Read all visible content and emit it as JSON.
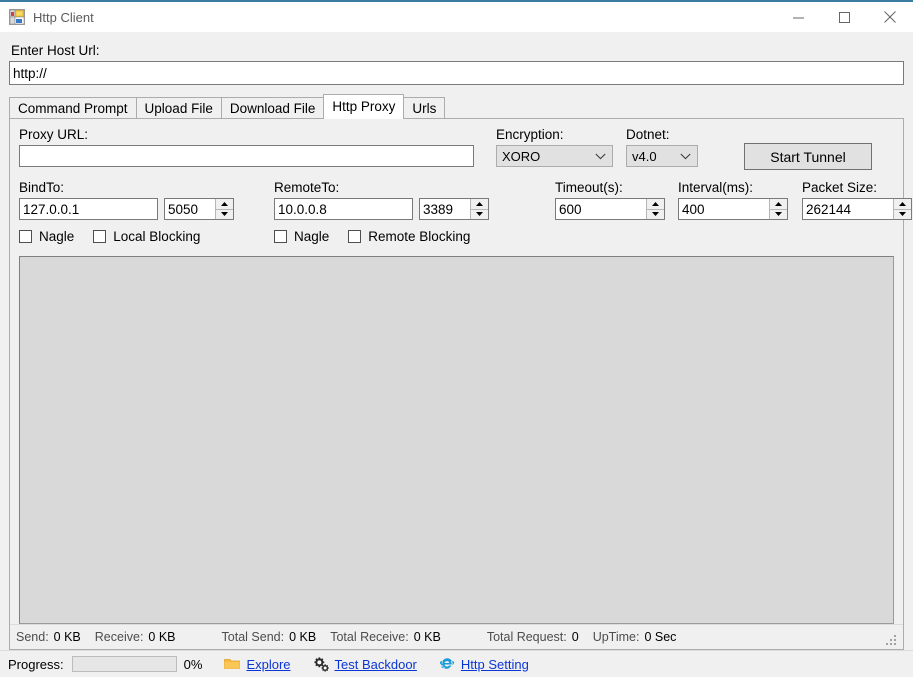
{
  "window": {
    "title": "Http Client",
    "icon": "winforms-app-icon",
    "controls": {
      "minimize": "minimize-icon",
      "maximize": "maximize-icon",
      "close": "close-icon"
    },
    "accent_color": "#3a7ca0"
  },
  "host": {
    "label": "Enter Host Url:",
    "value": "http://",
    "placeholder": ""
  },
  "tabs": [
    {
      "label": "Command Prompt",
      "active": false
    },
    {
      "label": "Upload File",
      "active": false
    },
    {
      "label": "Download File",
      "active": false
    },
    {
      "label": "Http Proxy",
      "active": true
    },
    {
      "label": "Urls",
      "active": false
    }
  ],
  "proxy": {
    "url_label": "Proxy URL:",
    "url_value": "",
    "url_placeholder": "",
    "encryption_label": "Encryption:",
    "encryption_value": "XORO",
    "dotnet_label": "Dotnet:",
    "dotnet_value": "v4.0",
    "start_button": "Start Tunnel",
    "bindto_label": "BindTo:",
    "bindto_host": "127.0.0.1",
    "bindto_port": "5050",
    "remoteto_label": "RemoteTo:",
    "remoteto_host": "10.0.0.8",
    "remoteto_port": "3389",
    "local_nagle_label": "Nagle",
    "local_blocking_label": "Local Blocking",
    "remote_nagle_label": "Nagle",
    "remote_blocking_label": "Remote Blocking",
    "timeout_label": "Timeout(s):",
    "timeout_value": "600",
    "interval_label": "Interval(ms):",
    "interval_value": "400",
    "packet_label": "Packet Size:",
    "packet_value": "262144",
    "log_text": ""
  },
  "inner_status": {
    "send_key": "Send:",
    "send_val": "0 KB",
    "receive_key": "Receive:",
    "receive_val": "0 KB",
    "total_send_key": "Total Send:",
    "total_send_val": "0 KB",
    "total_receive_key": "Total Receive:",
    "total_receive_val": "0 KB",
    "total_request_key": "Total Request:",
    "total_request_val": "0",
    "uptime_key": "UpTime:",
    "uptime_val": "0 Sec"
  },
  "statusbar": {
    "progress_label": "Progress:",
    "progress_percent": "0%",
    "progress_value": 0,
    "explore_label": "Explore",
    "explore_icon": "folder-icon",
    "backdoor_label": "Test Backdoor",
    "backdoor_icon": "gears-icon",
    "setting_label": "Http Setting",
    "setting_icon": "internet-explorer-icon",
    "link_color": "#0b36d6"
  }
}
